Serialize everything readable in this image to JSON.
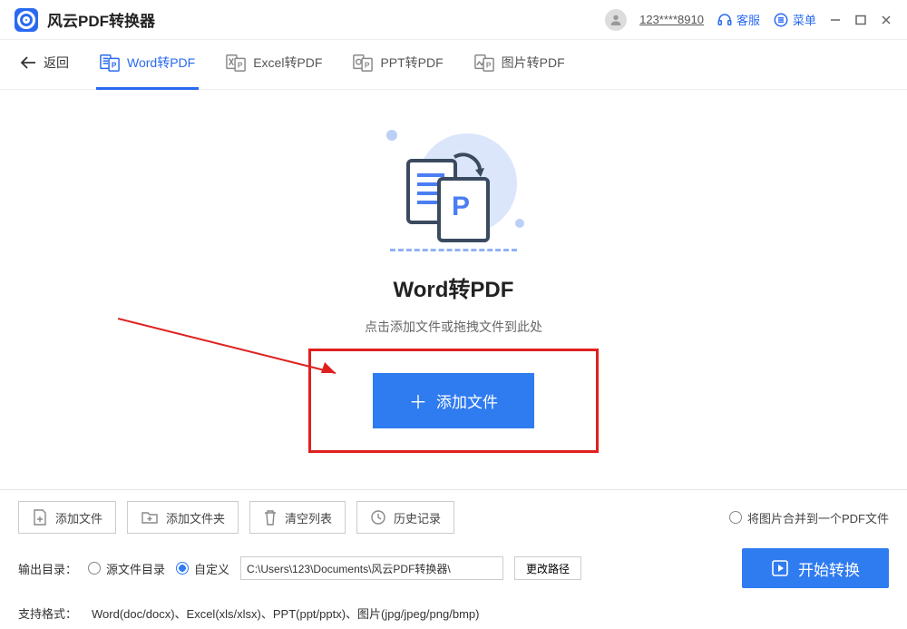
{
  "titlebar": {
    "app_name": "风云PDF转换器",
    "user_id": "123****8910",
    "support_label": "客服",
    "menu_label": "菜单"
  },
  "tabs": {
    "back_label": "返回",
    "items": [
      {
        "label": "Word转PDF"
      },
      {
        "label": "Excel转PDF"
      },
      {
        "label": "PPT转PDF"
      },
      {
        "label": "图片转PDF"
      }
    ]
  },
  "main": {
    "heading": "Word转PDF",
    "subheading": "点击添加文件或拖拽文件到此处",
    "add_button": "添加文件"
  },
  "toolbar": {
    "add_file": "添加文件",
    "add_folder": "添加文件夹",
    "clear_list": "清空列表",
    "history": "历史记录",
    "merge_option": "将图片合并到一个PDF文件"
  },
  "output": {
    "label": "输出目录：",
    "source_dir": "源文件目录",
    "custom": "自定义",
    "path": "C:\\Users\\123\\Documents\\风云PDF转换器\\",
    "change_path": "更改路径",
    "start_convert": "开始转换"
  },
  "formats": {
    "label": "支持格式：",
    "value": "Word(doc/docx)、Excel(xls/xlsx)、PPT(ppt/pptx)、图片(jpg/jpeg/png/bmp)"
  }
}
